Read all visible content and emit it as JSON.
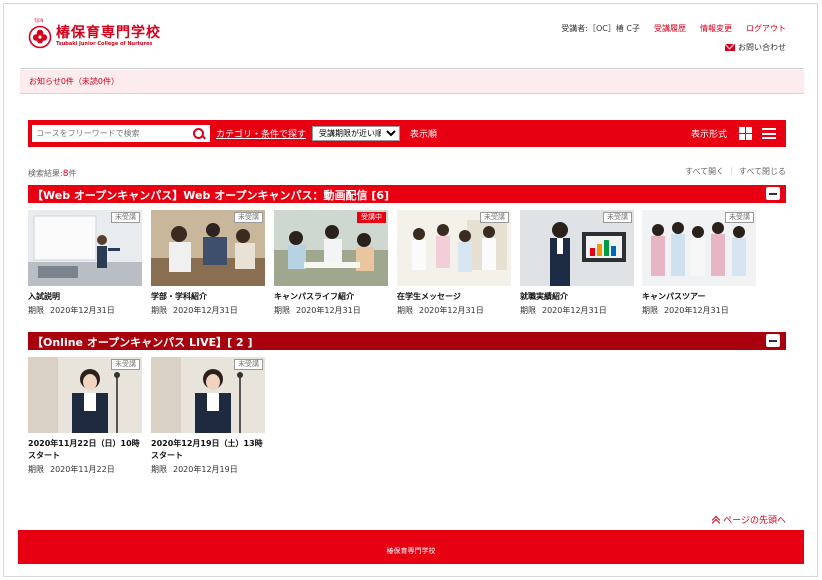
{
  "header": {
    "logo_jp": "椿保育専門学校",
    "logo_en": "Tsubaki Junior College of Nurtures",
    "logo_tiny": "TJCN",
    "user_label": "受講者:［OC］椿 C子",
    "nav": [
      "受講履歴",
      "情報変更",
      "ログアウト"
    ],
    "contact": "お問い合わせ"
  },
  "notice": "お知らせ0件（未読0件）",
  "search": {
    "placeholder": "コースをフリーワードで検索",
    "category_link": "カテゴリ・条件で探す",
    "sort_selected": "受講期限が近い順",
    "sort_label": "表示順",
    "view_label": "表示形式"
  },
  "results": {
    "prefix": "検索結果:",
    "count": "8",
    "suffix": "件"
  },
  "expand_all": "すべて開く",
  "collapse_all": "すべて閉じる",
  "categories": [
    {
      "title": "【Web オープンキャンパス】Web オープンキャンパス：動画配信 [6]",
      "courses": [
        {
          "title": "入試説明",
          "due_label": "期限",
          "due": "2020年12月31日",
          "status": "未受講"
        },
        {
          "title": "学部・学科紹介",
          "due_label": "期限",
          "due": "2020年12月31日",
          "status": "未受講"
        },
        {
          "title": "キャンパスライフ紹介",
          "due_label": "期限",
          "due": "2020年12月31日",
          "status": "受講中"
        },
        {
          "title": "在学生メッセージ",
          "due_label": "期限",
          "due": "2020年12月31日",
          "status": "未受講"
        },
        {
          "title": "就職実績紹介",
          "due_label": "期限",
          "due": "2020年12月31日",
          "status": "未受講"
        },
        {
          "title": "キャンパスツアー",
          "due_label": "期限",
          "due": "2020年12月31日",
          "status": "未受講"
        }
      ]
    },
    {
      "title": "【Online オープンキャンパス LIVE】[ 2 ]",
      "courses": [
        {
          "title": "2020年11月22日（日）10時スタート",
          "due_label": "期限",
          "due": "2020年11月22日",
          "status": "未受講"
        },
        {
          "title": "2020年12月19日（土）13時スタート",
          "due_label": "期限",
          "due": "2020年12月19日",
          "status": "未受講"
        }
      ]
    }
  ],
  "page_top": "ページの先頭へ",
  "footer": "椿保育専門学校",
  "colors": {
    "brand": "#e60012",
    "brand_dark": "#a8000d",
    "notice_bg": "#fdecee"
  }
}
